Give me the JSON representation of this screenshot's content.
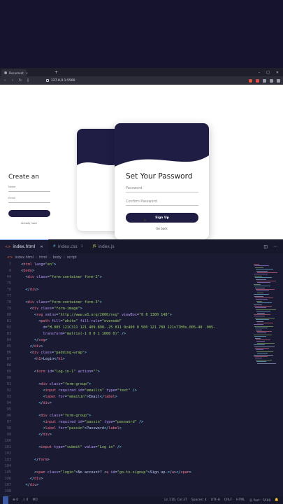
{
  "browser": {
    "tab_title": "Document",
    "url": "127.0.0.1:5500"
  },
  "page": {
    "back_card_title": "Create an",
    "front_card_title": "Set Your Password",
    "password_placeholder": "Password",
    "confirm_placeholder": "Confirm Password",
    "signup_label": "Sign Up",
    "go_back_label": "Go back"
  },
  "vscode": {
    "tabs": [
      {
        "label": "index.html",
        "type": "html"
      },
      {
        "label": "index.css",
        "type": "css",
        "modified": "1"
      },
      {
        "label": "index.js",
        "type": "js"
      }
    ],
    "breadcrumb": [
      "index.html",
      "html",
      "body",
      "script"
    ],
    "status": {
      "errors": "0",
      "warnings": "0",
      "position": "Ln 110, Col 27",
      "spaces": "Spaces: 4",
      "encoding": "UTF-8",
      "eol": "CRLF",
      "language": "HTML",
      "port": "Port : 5500"
    }
  },
  "colors": {
    "accent": "#1f1d44",
    "editor_bg": "#1a1b32"
  }
}
